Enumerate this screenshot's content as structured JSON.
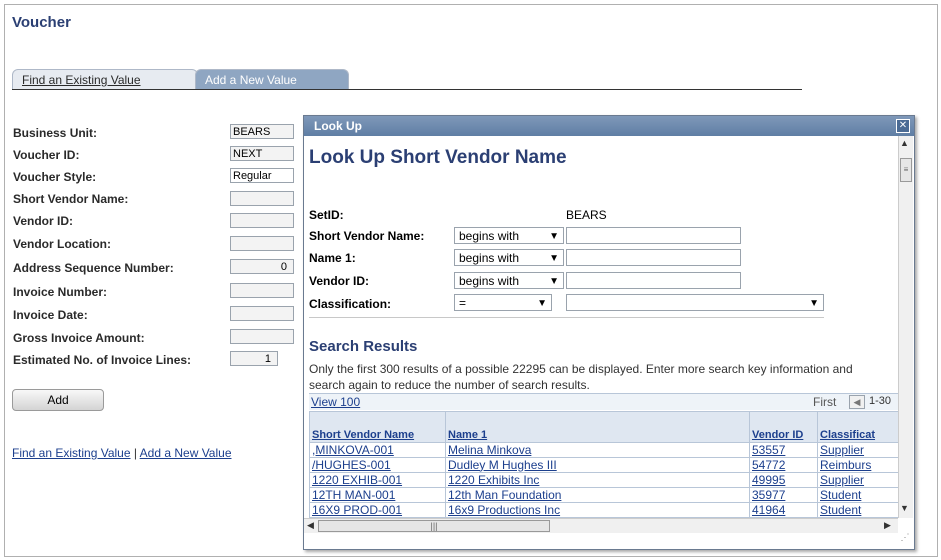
{
  "page": {
    "title": "Voucher",
    "tabs": [
      "Find an Existing Value",
      "Add a New Value"
    ],
    "fields": [
      {
        "label": "Business Unit:",
        "value": "BEARS"
      },
      {
        "label": "Voucher ID:",
        "value": "NEXT"
      },
      {
        "label": "Voucher Style:",
        "value": "Regular"
      },
      {
        "label": "Short Vendor Name:",
        "value": ""
      },
      {
        "label": "Vendor ID:",
        "value": ""
      },
      {
        "label": "Vendor Location:",
        "value": ""
      },
      {
        "label": "Address Sequence Number:",
        "value": "0"
      },
      {
        "label": "Invoice Number:",
        "value": ""
      },
      {
        "label": "Invoice Date:",
        "value": ""
      },
      {
        "label": "Gross Invoice Amount:",
        "value": ""
      },
      {
        "label": "Estimated No. of Invoice Lines:",
        "value": "1"
      }
    ],
    "add_button": "Add",
    "bottom_links": {
      "find": "Find an Existing Value",
      "separator": "|",
      "add": "Add a New Value"
    }
  },
  "lookup": {
    "window_title": "Look Up",
    "close_icon": "close-x",
    "heading": "Look Up Short Vendor Name",
    "setid": {
      "label": "SetID:",
      "value": "BEARS"
    },
    "criteria": [
      {
        "label": "Short Vendor Name:",
        "operator": "begins with",
        "value": ""
      },
      {
        "label": "Name 1:",
        "operator": "begins with",
        "value": ""
      },
      {
        "label": "Vendor ID:",
        "operator": "begins with",
        "value": ""
      },
      {
        "label": "Classification:",
        "operator": "=",
        "value": ""
      }
    ],
    "results_heading": "Search Results",
    "results_note": "Only the first 300 results of a possible 22295 can be displayed. Enter more search key information and search again to reduce the number of search results.",
    "nav": {
      "view_all": "View 100",
      "first": "First",
      "range": "1-30"
    },
    "columns": [
      "Short Vendor Name",
      "Name 1",
      "Vendor ID",
      "Classificat"
    ],
    "rows": [
      [
        ",MINKOVA-001",
        "Melina Minkova",
        "53557",
        "Supplier"
      ],
      [
        "/HUGHES-001",
        "Dudley M Hughes III",
        "54772",
        "Reimburs"
      ],
      [
        "1220 EXHIB-001",
        "1220 Exhibits Inc",
        "49995",
        "Supplier"
      ],
      [
        "12TH MAN-001",
        "12th Man Foundation",
        "35977",
        "Student"
      ],
      [
        "16X9 PROD-001",
        "16x9 Productions Inc",
        "41964",
        "Student"
      ]
    ]
  }
}
